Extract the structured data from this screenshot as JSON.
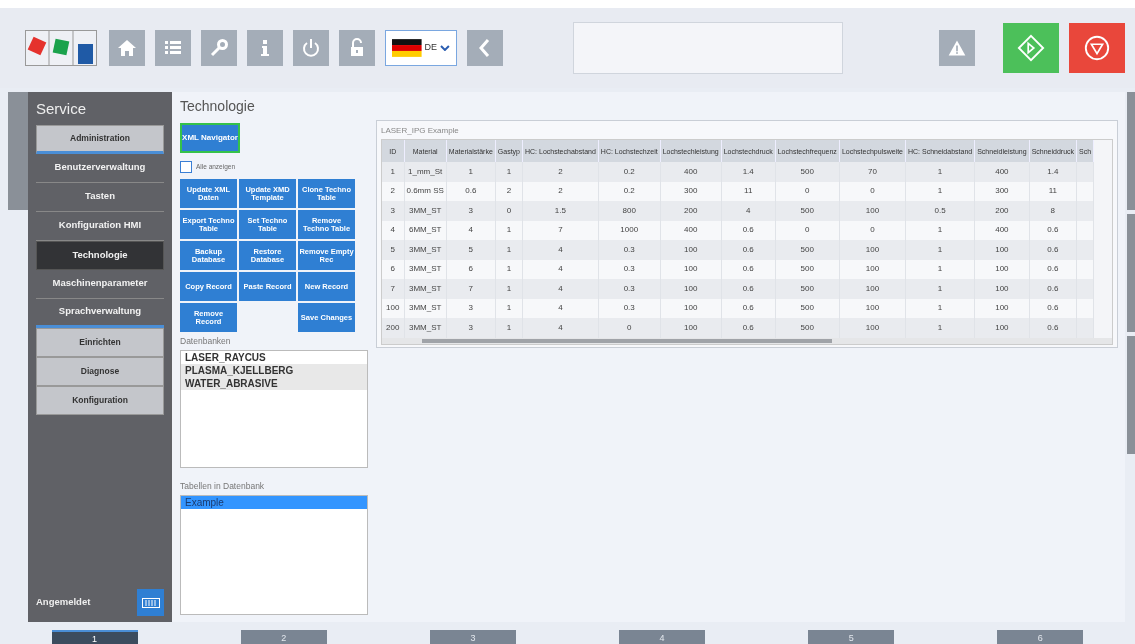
{
  "toolbar": {
    "language": "DE"
  },
  "sidebar": {
    "title": "Service",
    "items": [
      {
        "label": "Administration",
        "kind": "group",
        "selected": false
      },
      {
        "label": "Benutzerverwaltung",
        "kind": "sub",
        "selected": false
      },
      {
        "label": "Tasten",
        "kind": "sub",
        "selected": false
      },
      {
        "label": "Konfiguration HMI",
        "kind": "sub",
        "selected": false
      },
      {
        "label": "Technologie",
        "kind": "sub",
        "selected": true
      },
      {
        "label": "Maschinenparameter",
        "kind": "sub",
        "selected": false
      },
      {
        "label": "Sprachverwaltung",
        "kind": "sub",
        "selected": false
      },
      {
        "label": "Einrichten",
        "kind": "group",
        "selected": false
      },
      {
        "label": "Diagnose",
        "kind": "group",
        "selected": false
      },
      {
        "label": "Konfiguration",
        "kind": "group",
        "selected": false
      }
    ],
    "user": {
      "label": "Angemeldet"
    }
  },
  "page": {
    "title": "Technologie",
    "xml_button": "XML Navigator",
    "show_all": {
      "label": "Alle anzeigen",
      "checked": false
    },
    "actions": [
      {
        "kind": "button",
        "label": "Update XML Daten"
      },
      {
        "kind": "button",
        "label": "Update XMD Template"
      },
      {
        "kind": "button",
        "label": "Clone Techno Table"
      },
      {
        "kind": "button",
        "label": "Export Techno Table"
      },
      {
        "kind": "button",
        "label": "Set Techno Table"
      },
      {
        "kind": "button",
        "label": "Remove Techno Table"
      },
      {
        "kind": "button",
        "label": "Backup Database"
      },
      {
        "kind": "button",
        "label": "Restore Database"
      },
      {
        "kind": "button",
        "label": "Remove Empty Rec"
      },
      {
        "kind": "button",
        "label": "Copy Record"
      },
      {
        "kind": "button",
        "label": "Paste Record"
      },
      {
        "kind": "button",
        "label": "New Record"
      },
      {
        "kind": "button",
        "label": "Remove Record"
      },
      {
        "kind": "gap"
      },
      {
        "kind": "button",
        "label": "Save Changes"
      }
    ],
    "databases": {
      "label": "Datenbanken",
      "items": [
        {
          "label": "LASER_RAYCUS",
          "highlighted": false
        },
        {
          "label": "PLASMA_KJELLBERG",
          "highlighted": true
        },
        {
          "label": "WATER_ABRASIVE",
          "highlighted": true
        }
      ]
    },
    "tables": {
      "label": "Tabellen in Datenbank",
      "items": [
        {
          "label": "Example",
          "selected": true
        }
      ]
    },
    "grid": {
      "title": "LASER_IPG  Example",
      "columns": [
        "ID",
        "Material",
        "Materialstärke",
        "Gastyp",
        "HC: Lochstechabstand",
        "HC: Lochstechzeit",
        "Lochstechleistung",
        "Lochstechdruck",
        "Lochstechfrequenz",
        "Lochstechpulsweite",
        "HC: Schneidabstand",
        "Schneidleistung",
        "Schneiddruck",
        "Sch"
      ],
      "rows": [
        [
          "1",
          "1_mm_St",
          "1",
          "1",
          "2",
          "0.2",
          "400",
          "1.4",
          "500",
          "70",
          "1",
          "400",
          "1.4"
        ],
        [
          "2",
          "0.6mm SS",
          "0.6",
          "2",
          "2",
          "0.2",
          "300",
          "11",
          "0",
          "0",
          "1",
          "300",
          "11"
        ],
        [
          "3",
          "3MM_ST",
          "3",
          "0",
          "1.5",
          "800",
          "200",
          "4",
          "500",
          "100",
          "0.5",
          "200",
          "8"
        ],
        [
          "4",
          "6MM_ST",
          "4",
          "1",
          "7",
          "1000",
          "400",
          "0.6",
          "0",
          "0",
          "1",
          "400",
          "0.6"
        ],
        [
          "5",
          "3MM_ST",
          "5",
          "1",
          "4",
          "0.3",
          "100",
          "0.6",
          "500",
          "100",
          "1",
          "100",
          "0.6"
        ],
        [
          "6",
          "3MM_ST",
          "6",
          "1",
          "4",
          "0.3",
          "100",
          "0.6",
          "500",
          "100",
          "1",
          "100",
          "0.6"
        ],
        [
          "7",
          "3MM_ST",
          "7",
          "1",
          "4",
          "0.3",
          "100",
          "0.6",
          "500",
          "100",
          "1",
          "100",
          "0.6"
        ],
        [
          "100",
          "3MM_ST",
          "3",
          "1",
          "4",
          "0.3",
          "100",
          "0.6",
          "500",
          "100",
          "1",
          "100",
          "0.6"
        ],
        [
          "200",
          "3MM_ST",
          "3",
          "1",
          "4",
          "0",
          "100",
          "0.6",
          "500",
          "100",
          "1",
          "100",
          "0.6"
        ]
      ]
    }
  },
  "pages": [
    {
      "label": "1",
      "selected": true
    },
    {
      "label": "2",
      "selected": false
    },
    {
      "label": "3",
      "selected": false
    },
    {
      "label": "4",
      "selected": false
    },
    {
      "label": "5",
      "selected": false
    },
    {
      "label": "6",
      "selected": false
    }
  ]
}
